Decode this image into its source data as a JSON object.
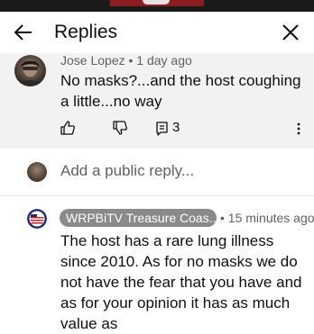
{
  "header": {
    "title": "Replies"
  },
  "parent_comment": {
    "author": "Jose Lopez",
    "separator": "•",
    "time": "1 day ago",
    "text": "No masks?...and the host coughing a little...no way",
    "reply_count": "3"
  },
  "add_reply": {
    "placeholder": "Add a public reply..."
  },
  "reply": {
    "channel": "WRPBiTV Treasure Coas...",
    "separator": "•",
    "time": "15 minutes ago",
    "text": "The host has a rare lung illness since 2010. As for no masks we do not have the fear that you have and as for your opinion it has as much value as"
  },
  "icons": {
    "back": "arrow-left-icon",
    "close": "close-icon",
    "like": "thumbs-up-icon",
    "dislike": "thumbs-down-icon",
    "replies": "comment-icon",
    "more": "more-vertical-icon"
  },
  "colors": {
    "chip": "#8a8a8a",
    "parent_bg": "#f2f2f2",
    "muted_text": "#606060"
  }
}
